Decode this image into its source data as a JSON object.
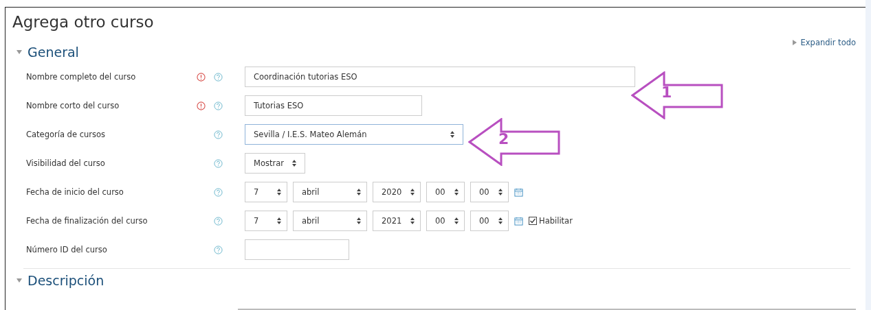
{
  "page_title": "Agrega otro curso",
  "expand_all": "Expandir todo",
  "sections": [
    {
      "title": "General",
      "expanded": true,
      "rows": [
        {
          "label": "Nombre completo del curso",
          "required": true,
          "kind": "text",
          "value": "Coordinación tutorias ESO"
        },
        {
          "label": "Nombre corto del curso",
          "required": true,
          "kind": "text",
          "value": "Tutorias ESO"
        },
        {
          "label": "Categoría de cursos",
          "required": false,
          "kind": "select",
          "value": "Sevilla / I.E.S. Mateo Alemán",
          "focused": true
        },
        {
          "label": "Visibilidad del curso",
          "required": false,
          "kind": "select",
          "value": "Mostrar",
          "focused": false
        },
        {
          "label": "Fecha de inicio del curso",
          "required": false,
          "kind": "date",
          "parts": [
            "7",
            "abril",
            "2020",
            "00",
            "00"
          ]
        },
        {
          "label": "Fecha de finalización del curso",
          "required": false,
          "kind": "date",
          "parts": [
            "7",
            "abril",
            "2021",
            "00",
            "00"
          ],
          "enable": {
            "label": "Habilitar",
            "checked": true
          }
        },
        {
          "label": "Número ID del curso",
          "required": false,
          "kind": "text",
          "value": ""
        }
      ]
    },
    {
      "title": "Descripción",
      "expanded": true
    }
  ],
  "callouts": [
    {
      "number": "1"
    },
    {
      "number": "2"
    }
  ]
}
